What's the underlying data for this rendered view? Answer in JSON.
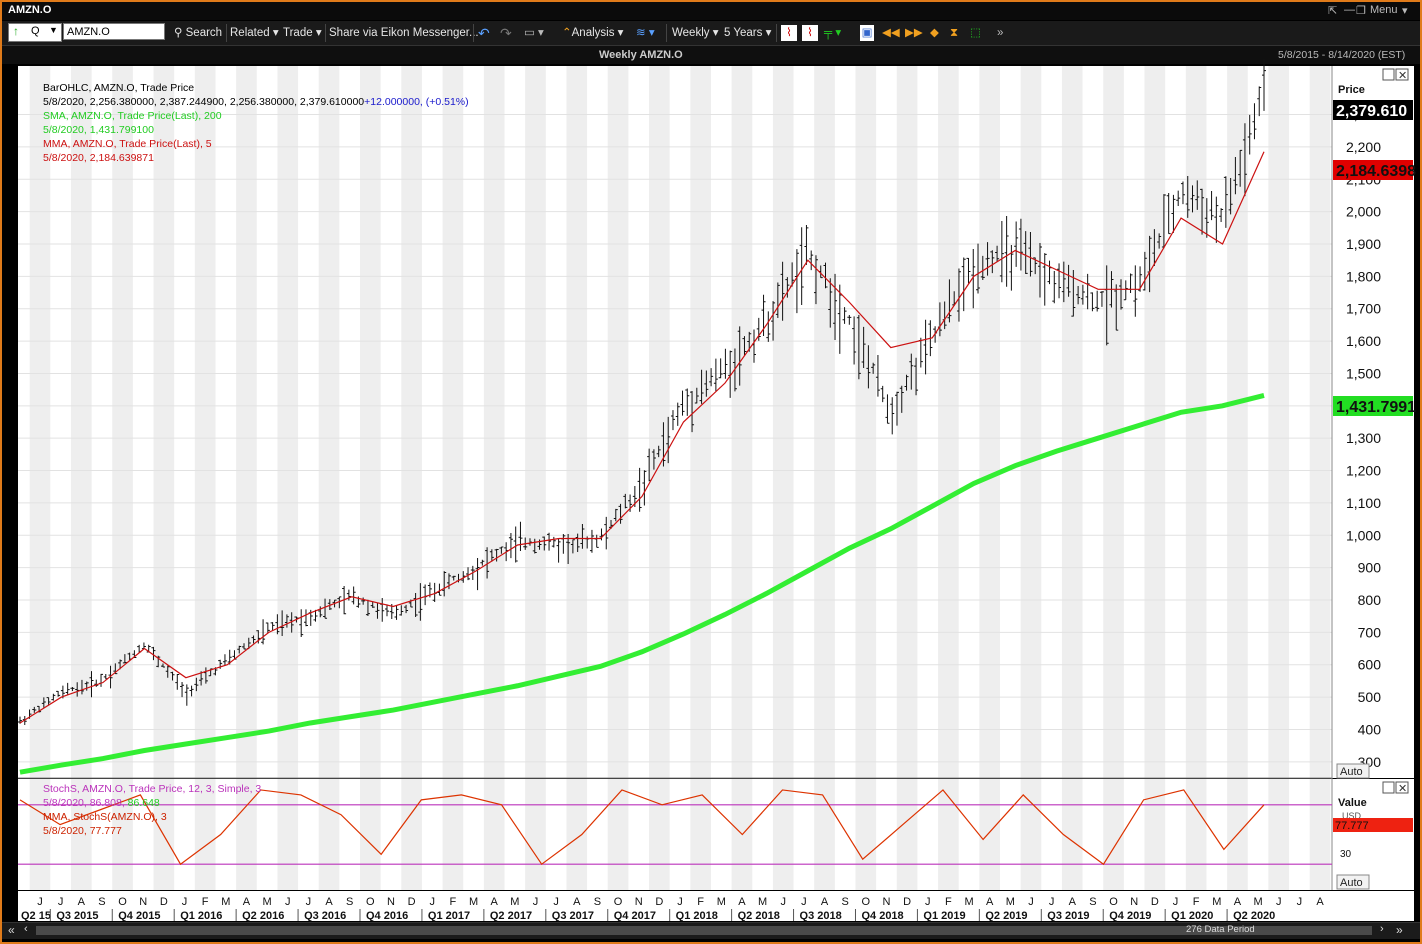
{
  "window": {
    "title": "AMZN.O",
    "menu_label": "Menu"
  },
  "toolbar": {
    "ric_prefix": "Q",
    "ric_value": "AMZN.O",
    "search": "Search",
    "related": "Related",
    "trade": "Trade",
    "share": "Share via Eikon Messenger...",
    "analysis": "Analysis",
    "interval": "Weekly",
    "range": "5 Years"
  },
  "chart_header": {
    "title": "Weekly AMZN.O",
    "date_range": "5/8/2015 - 8/14/2020 (EST)"
  },
  "legend_main": [
    {
      "text": "BarOHLC, AMZN.O, Trade Price",
      "color": "#000000"
    },
    {
      "text": "5/8/2020, 2,256.380000, 2,387.244900, 2,256.380000, 2,379.610000",
      "color": "#000000",
      "extra": "+12.000000, (+0.51%)",
      "extra_color": "#1a1acc"
    },
    {
      "text": "SMA, AMZN.O, Trade Price(Last), 200",
      "color": "#22cc22"
    },
    {
      "text": "5/8/2020, 1,431.799100",
      "color": "#22cc22"
    },
    {
      "text": "MMA, AMZN.O, Trade Price(Last), 5",
      "color": "#cc1111"
    },
    {
      "text": "5/8/2020, 2,184.639871",
      "color": "#cc1111"
    }
  ],
  "legend_stoch": [
    {
      "text": "StochS, AMZN.O, Trade Price, 12, 3, Simple, 3",
      "color": "#bb33bb"
    },
    {
      "text": "5/8/2020, 86.808, ",
      "color": "#bb33bb",
      "extra": "86.648",
      "extra_color": "#22cc22"
    },
    {
      "text": "MMA, StochS(AMZN.O), 3",
      "color": "#cc2200"
    },
    {
      "text": "5/8/2020, 77.777",
      "color": "#cc2200"
    }
  ],
  "price_axis": {
    "label": "Price",
    "ticks": [
      "2,300",
      "2,200",
      "2,100",
      "2,000",
      "1,900",
      "1,800",
      "1,700",
      "1,600",
      "1,500",
      "1,400",
      "1,300",
      "1,200",
      "1,100",
      "1,000",
      "900",
      "800",
      "700",
      "600",
      "500",
      "400",
      "300"
    ],
    "last_price": "2,379.610",
    "mma_flag": "2,184.6398",
    "sma_flag": "1,431.7991",
    "auto": "Auto",
    "colors": {
      "last": "#000000",
      "mma": "#e00000",
      "sma": "#22dd22"
    }
  },
  "stoch_axis": {
    "label": "Value",
    "unit": "USD",
    "flag": "77.777",
    "tick": "30",
    "auto": "Auto"
  },
  "x_axis": {
    "months": [
      "J",
      "J",
      "A",
      "S",
      "O",
      "N",
      "D",
      "J",
      "F",
      "M",
      "A",
      "M",
      "J",
      "J",
      "A",
      "S",
      "O",
      "N",
      "D",
      "J",
      "F",
      "M",
      "A",
      "M",
      "J",
      "J",
      "A",
      "S",
      "O",
      "N",
      "D",
      "J",
      "F",
      "M",
      "A",
      "M",
      "J",
      "J",
      "A",
      "S",
      "O",
      "N",
      "D",
      "J",
      "F",
      "M",
      "A",
      "M",
      "J",
      "J",
      "A",
      "S",
      "O",
      "N",
      "D",
      "J",
      "F",
      "M",
      "A",
      "M",
      "J",
      "J",
      "A"
    ],
    "quarters": [
      "Q2 15",
      "Q3 2015",
      "Q4 2015",
      "Q1 2016",
      "Q2 2016",
      "Q3 2016",
      "Q4 2016",
      "Q1 2017",
      "Q2 2017",
      "Q3 2017",
      "Q4 2017",
      "Q1 2018",
      "Q2 2018",
      "Q3 2018",
      "Q4 2018",
      "Q1 2019",
      "Q2 2019",
      "Q3 2019",
      "Q4 2019",
      "Q1 2020",
      "Q2 2020"
    ]
  },
  "status": {
    "data_period": "276 Data Period"
  },
  "chart_data": {
    "type": "line",
    "title": "Weekly AMZN.O",
    "ylim": [
      250,
      2450
    ],
    "x": [
      "2015-06",
      "2015-08",
      "2015-10",
      "2015-12",
      "2016-02",
      "2016-04",
      "2016-06",
      "2016-08",
      "2016-10",
      "2016-12",
      "2017-02",
      "2017-04",
      "2017-06",
      "2017-08",
      "2017-10",
      "2017-12",
      "2018-02",
      "2018-04",
      "2018-06",
      "2018-08",
      "2018-10",
      "2018-12",
      "2019-02",
      "2019-04",
      "2019-06",
      "2019-08",
      "2019-10",
      "2019-12",
      "2020-02",
      "2020-04",
      "2020-05"
    ],
    "series": [
      {
        "name": "BarOHLC, AMZN.O, Trade Price",
        "values": [
          430,
          520,
          560,
          670,
          520,
          620,
          720,
          760,
          820,
          760,
          840,
          910,
          990,
          980,
          1000,
          1170,
          1420,
          1530,
          1680,
          1890,
          1680,
          1400,
          1630,
          1850,
          1900,
          1800,
          1740,
          1800,
          2080,
          2000,
          2380
        ]
      },
      {
        "name": "SMA, AMZN.O, Trade Price(Last), 200",
        "values": [
          268,
          290,
          310,
          335,
          355,
          375,
          395,
          420,
          440,
          460,
          485,
          510,
          535,
          565,
          595,
          640,
          695,
          755,
          820,
          890,
          960,
          1020,
          1090,
          1160,
          1215,
          1260,
          1300,
          1340,
          1380,
          1400,
          1432
        ]
      },
      {
        "name": "MMA, AMZN.O, Trade Price(Last), 5",
        "values": [
          420,
          500,
          545,
          650,
          560,
          600,
          700,
          760,
          810,
          780,
          820,
          890,
          970,
          990,
          990,
          1120,
          1350,
          1470,
          1650,
          1850,
          1720,
          1580,
          1610,
          1800,
          1880,
          1820,
          1760,
          1760,
          1980,
          1900,
          2185
        ]
      }
    ],
    "stoch": {
      "ylim": [
        0,
        100
      ],
      "upper": 80,
      "lower": 20,
      "series": [
        {
          "name": "MMA, StochS(AMZN.O), 3",
          "values": [
            85,
            60,
            75,
            90,
            20,
            50,
            95,
            90,
            70,
            30,
            85,
            90,
            80,
            20,
            50,
            95,
            80,
            90,
            50,
            95,
            90,
            25,
            60,
            95,
            45,
            90,
            50,
            20,
            85,
            95,
            35,
            80
          ]
        }
      ]
    }
  }
}
